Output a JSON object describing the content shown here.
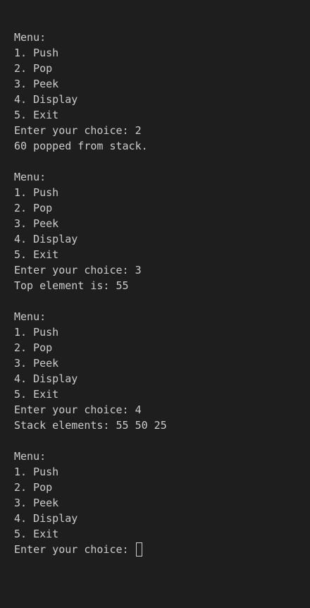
{
  "terminal": {
    "lines": [
      "Menu:",
      "1. Push",
      "2. Pop",
      "3. Peek",
      "4. Display",
      "5. Exit",
      "Enter your choice: 2",
      "60 popped from stack.",
      "",
      "Menu:",
      "1. Push",
      "2. Pop",
      "3. Peek",
      "4. Display",
      "5. Exit",
      "Enter your choice: 3",
      "Top element is: 55",
      "",
      "Menu:",
      "1. Push",
      "2. Pop",
      "3. Peek",
      "4. Display",
      "5. Exit",
      "Enter your choice: 4",
      "Stack elements: 55 50 25",
      "",
      "Menu:",
      "1. Push",
      "2. Pop",
      "3. Peek",
      "4. Display",
      "5. Exit"
    ],
    "prompt": "Enter your choice: ",
    "colors": {
      "background": "#1e1e1e",
      "foreground": "#cccccc"
    }
  }
}
